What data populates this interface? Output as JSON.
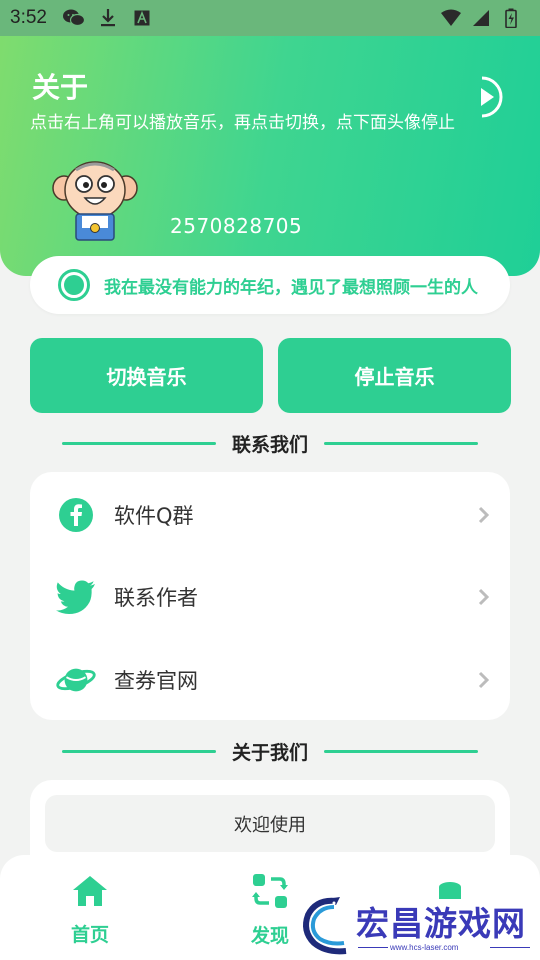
{
  "status_bar": {
    "time": "3:52",
    "left_icons": [
      "wechat-icon",
      "download-icon",
      "font-icon"
    ],
    "right_icons": [
      "wifi-icon",
      "signal-icon",
      "battery-icon"
    ]
  },
  "header": {
    "title": "关于",
    "subtitle": "点击右上角可以播放音乐，再点击切换，点下面头像停止",
    "user_id": "2570828705",
    "play_icon": "play-circle-icon"
  },
  "quote": {
    "text": "我在最没有能力的年纪，遇见了最想照顾一生的人"
  },
  "actions": {
    "switch_music": "切换音乐",
    "stop_music": "停止音乐"
  },
  "contact_section": {
    "title": "联系我们",
    "items": [
      {
        "label": "软件Q群",
        "icon": "facebook-icon"
      },
      {
        "label": "联系作者",
        "icon": "twitter-icon"
      },
      {
        "label": "查券官网",
        "icon": "planet-icon"
      }
    ]
  },
  "about_section": {
    "title": "关于我们",
    "welcome": "欢迎使用"
  },
  "bottom_nav": {
    "items": [
      {
        "label": "首页",
        "icon": "home-icon"
      },
      {
        "label": "发现",
        "icon": "discover-icon"
      },
      {
        "label": "",
        "icon": "profile-icon"
      }
    ]
  },
  "watermark": {
    "title": "宏昌游戏网",
    "url": "www.hcs-laser.com"
  },
  "colors": {
    "accent": "#2ecf92",
    "header_start": "#7fdc6e",
    "header_end": "#1fcf97",
    "background": "#f2f3f2",
    "watermark": "#3a3ab8"
  }
}
